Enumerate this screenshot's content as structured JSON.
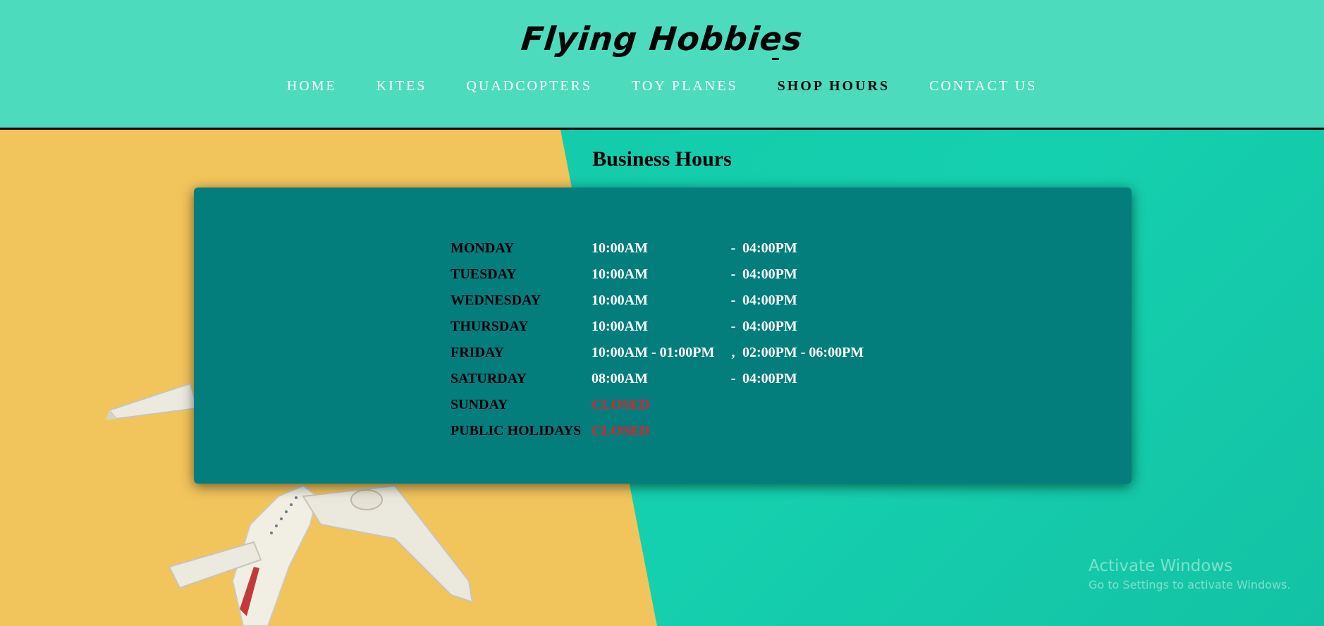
{
  "header": {
    "logo": "Flying Hobbies",
    "nav": [
      {
        "label": "HOME",
        "active": false
      },
      {
        "label": "KITES",
        "active": false
      },
      {
        "label": "QUADCOPTERS",
        "active": false
      },
      {
        "label": "TOY PLANES",
        "active": false
      },
      {
        "label": "SHOP HOURS",
        "active": true
      },
      {
        "label": "CONTACT US",
        "active": false
      }
    ]
  },
  "main": {
    "title": "Business Hours",
    "hours": [
      {
        "day": "MONDAY",
        "open": "10:00AM",
        "sep": "-",
        "close": "04:00PM"
      },
      {
        "day": "TUESDAY",
        "open": "10:00AM",
        "sep": "-",
        "close": "04:00PM"
      },
      {
        "day": "WEDNESDAY",
        "open": "10:00AM",
        "sep": "-",
        "close": "04:00PM"
      },
      {
        "day": "THURSDAY",
        "open": "10:00AM",
        "sep": "-",
        "close": "04:00PM"
      },
      {
        "day": "FRIDAY",
        "open": "10:00AM - 01:00PM",
        "sep": ",",
        "close": "02:00PM - 06:00PM"
      },
      {
        "day": "SATURDAY",
        "open": "08:00AM",
        "sep": "-",
        "close": "04:00PM"
      },
      {
        "day": "SUNDAY",
        "open": "CLOSED",
        "sep": "",
        "close": ""
      },
      {
        "day": "PUBLIC HOLIDAYS",
        "open": "CLOSED",
        "sep": "",
        "close": ""
      }
    ]
  },
  "watermark": {
    "line1": "Activate Windows",
    "line2": "Go to Settings to activate Windows."
  },
  "colors": {
    "header_bg": "#4cdcbd",
    "card_bg": "#047d7d",
    "closed": "#e3202a",
    "yellow": "#f2c45c",
    "teal": "#14ccaa"
  }
}
